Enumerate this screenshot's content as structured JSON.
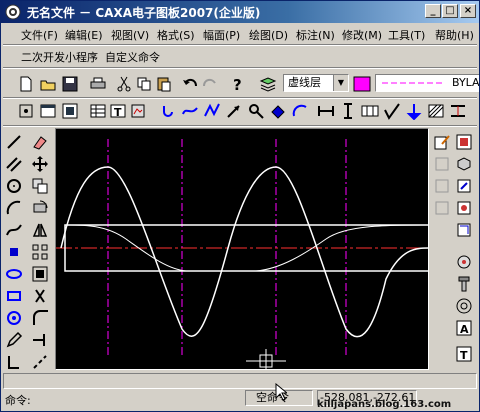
{
  "window": {
    "title": "无名文件 － CAXA电子图板2007(企业版)",
    "buttons": [
      "_",
      "□",
      "×"
    ]
  },
  "menu": [
    {
      "label": "文件(F)"
    },
    {
      "label": "编辑(E)"
    },
    {
      "label": "视图(V)"
    },
    {
      "label": "格式(S)"
    },
    {
      "label": "幅面(P)"
    },
    {
      "label": "绘图(D)"
    },
    {
      "label": "标注(N)"
    },
    {
      "label": "修改(M)"
    },
    {
      "label": "工具(T)"
    },
    {
      "label": "帮助(H)"
    }
  ],
  "menu2": [
    {
      "label": "二次开发小程序"
    },
    {
      "label": "自定义命令"
    }
  ],
  "layer_combo": {
    "value": "虚线层"
  },
  "color_swatch": "#ff00ff",
  "linetype_combo": {
    "value": "BYLAY"
  },
  "status": {
    "command_label": "命令:",
    "command_state": "空命令",
    "coordinates": "-528.081,-272.611"
  },
  "watermark": "killjapans.blog.163.com",
  "colors": {
    "canvas_bg": "#000000",
    "curve": "#ffffff",
    "centerline_red": "#ff3030",
    "centerline_magenta": "#ff00ff"
  }
}
